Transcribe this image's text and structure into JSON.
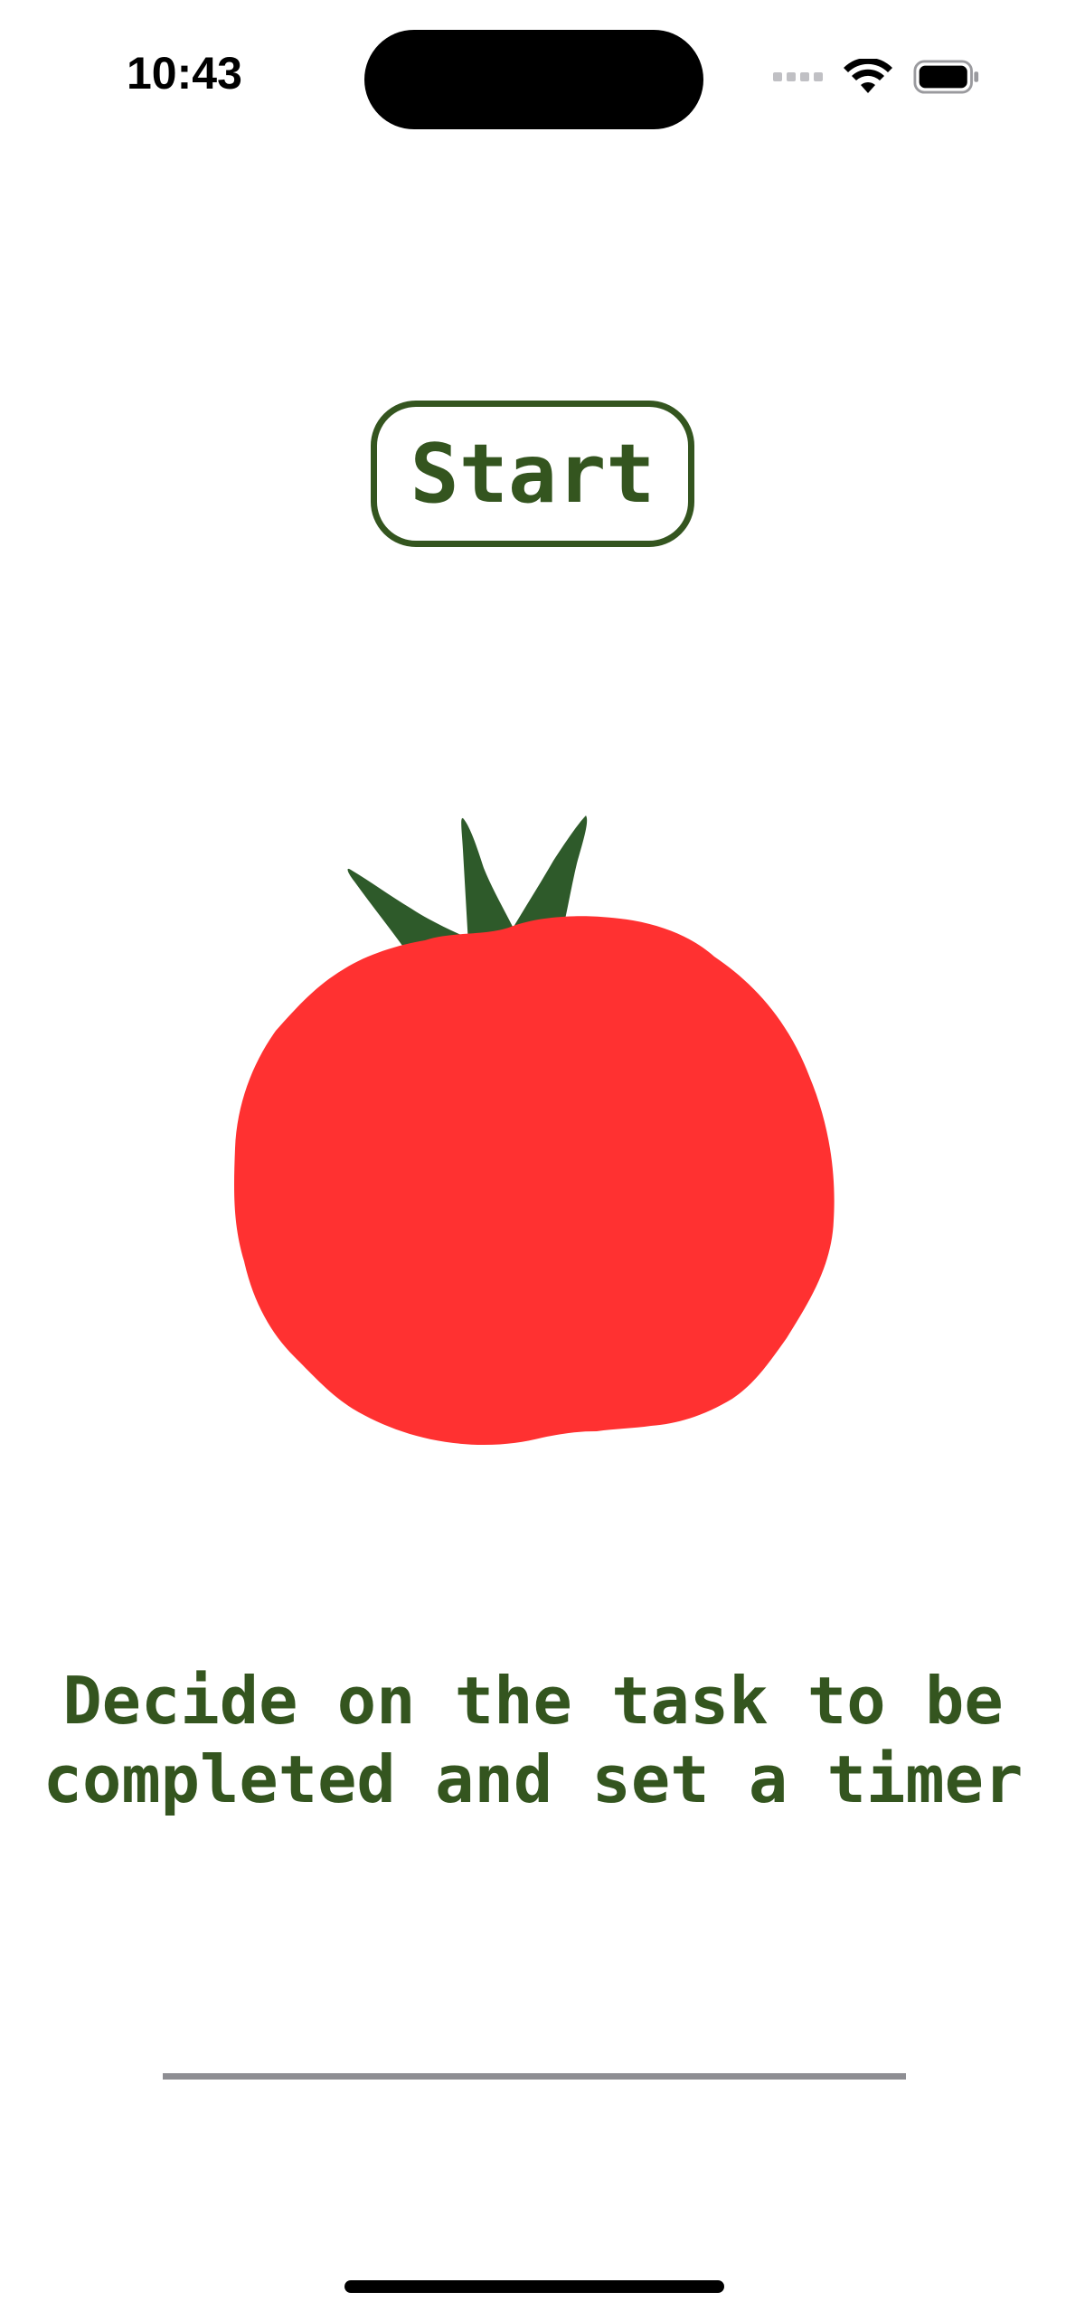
{
  "status_bar": {
    "time": "10:43",
    "icons": [
      "cellular-signal-icon",
      "wifi-icon",
      "battery-icon"
    ]
  },
  "main": {
    "start_label": "Start",
    "instruction": "Decide on the task to be completed and set a timer",
    "task_input": {
      "value": "",
      "placeholder": ""
    }
  },
  "colors": {
    "accent_green": "#34551f",
    "tomato_red": "#ff3131",
    "leaf_green": "#2e5a2a",
    "underline_gray": "#8e8e93"
  }
}
